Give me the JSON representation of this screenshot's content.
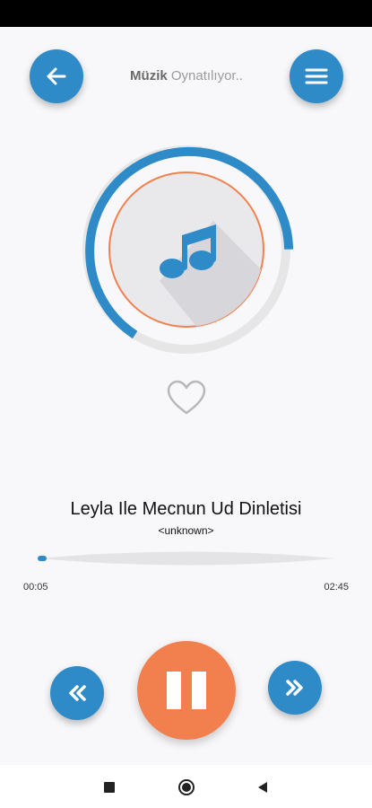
{
  "header": {
    "title_bold": "Müzik",
    "title_light": "Oynatılıyor.."
  },
  "icons": {
    "back": "arrow-left-icon",
    "menu": "hamburger-menu-icon",
    "album_art": "music-note-icon",
    "favorite": "heart-outline-icon",
    "rewind": "double-chevron-left-icon",
    "pause": "pause-icon",
    "fast_forward": "double-chevron-right-icon"
  },
  "track": {
    "title": "Leyla Ile Mecnun Ud Dinletisi",
    "artist": "<unknown>",
    "current_time": "00:05",
    "total_time": "02:45",
    "progress": 0.03
  },
  "colors": {
    "accent_blue": "#2f8bc8",
    "accent_orange": "#f2804f",
    "status_bar": "#000000"
  },
  "navbar": {
    "items": [
      "recents",
      "home",
      "back"
    ]
  }
}
